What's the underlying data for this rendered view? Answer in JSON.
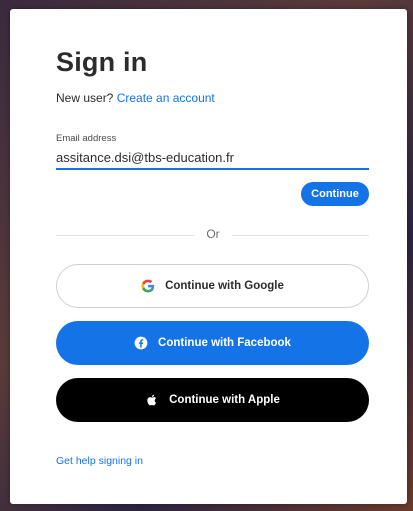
{
  "signin": {
    "title": "Sign in",
    "new_user_text": "New user?",
    "create_account_link": "Create an account",
    "email_label": "Email address",
    "email_value": "assitance.dsi@tbs-education.fr",
    "continue_label": "Continue",
    "or_text": "Or",
    "google_label": "Continue with Google",
    "facebook_label": "Continue with Facebook",
    "apple_label": "Continue with Apple",
    "help_link": "Get help signing in"
  },
  "icons": {
    "google": "google-icon",
    "facebook": "facebook-icon",
    "apple": "apple-icon"
  },
  "colors": {
    "accent": "#1473e6",
    "apple_button": "#000000",
    "card_background": "#ffffff"
  }
}
